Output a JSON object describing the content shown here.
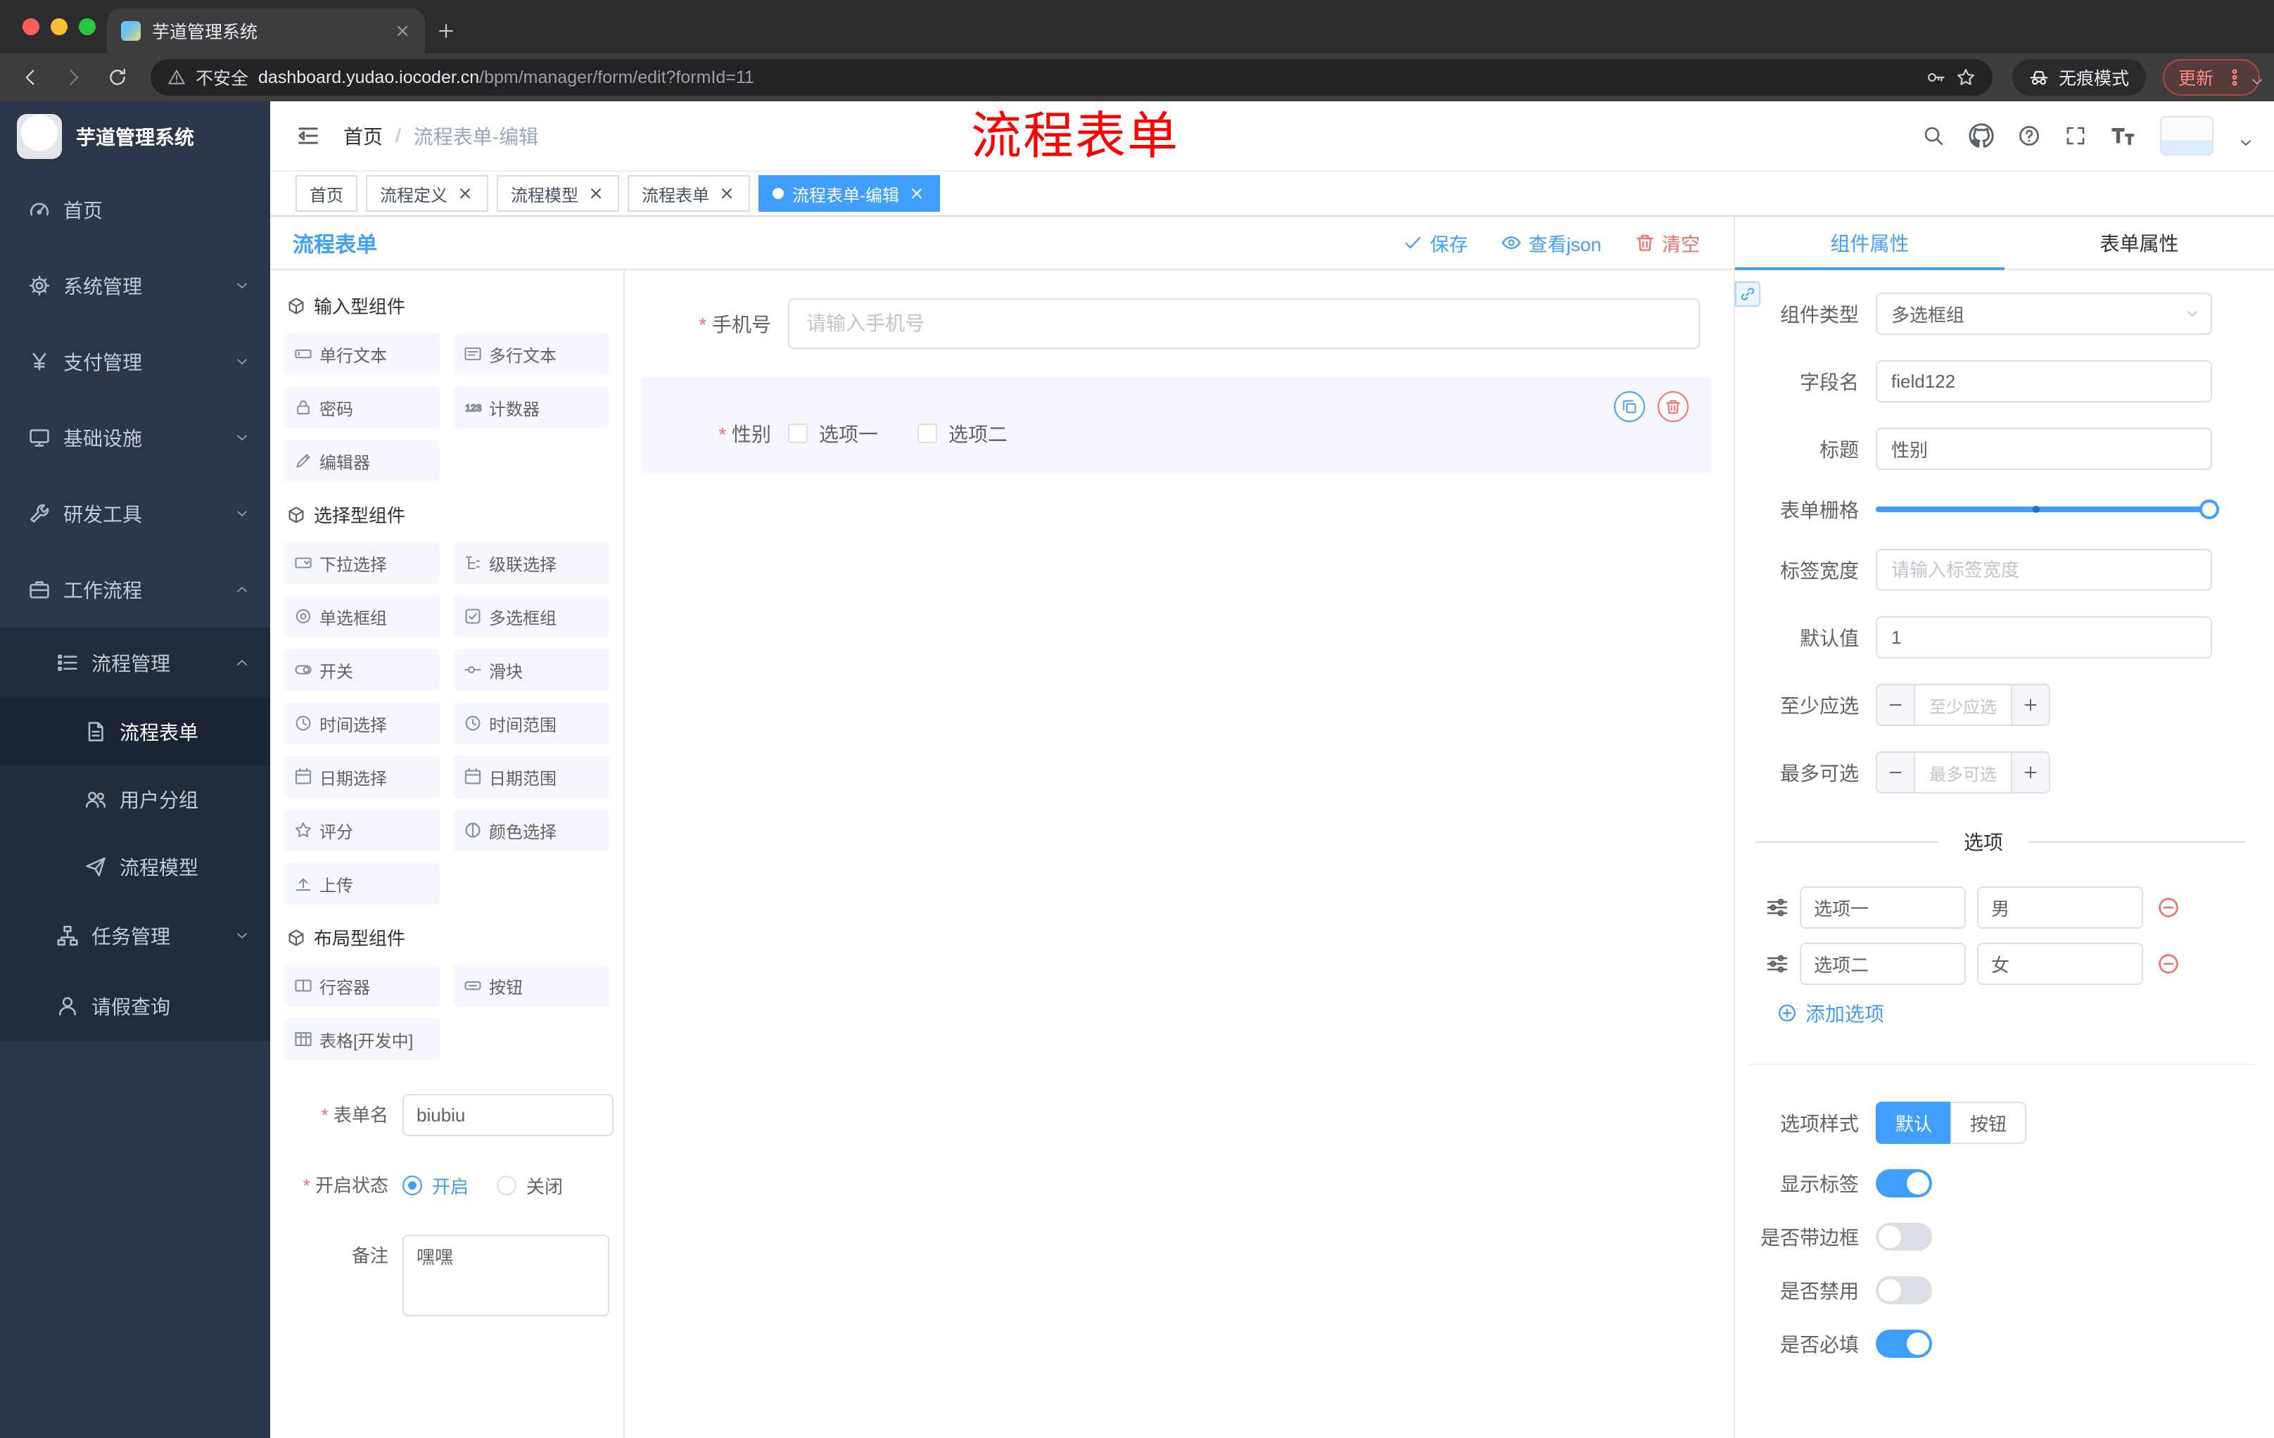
{
  "colors": {
    "accent": "#409eff",
    "danger": "#f56c6c",
    "annotation": "#ff0000"
  },
  "browser": {
    "tab_title": "芋道管理系统",
    "security": "不安全",
    "url_host": "dashboard.yudao.iocoder.cn",
    "url_path": "/bpm/manager/form/edit?formId=11",
    "incognito": "无痕模式",
    "update": "更新"
  },
  "sidebar": {
    "logo_title": "芋道管理系统",
    "items": [
      {
        "label": "首页",
        "icon": "dashboard-icon"
      },
      {
        "label": "系统管理",
        "icon": "gear-icon"
      },
      {
        "label": "支付管理",
        "icon": "yen-icon"
      },
      {
        "label": "基础设施",
        "icon": "monitor-icon"
      },
      {
        "label": "研发工具",
        "icon": "wrench-icon"
      },
      {
        "label": "工作流程",
        "icon": "briefcase-icon"
      },
      {
        "label": "流程管理",
        "icon": "list-icon"
      },
      {
        "label": "流程表单",
        "icon": "form-icon"
      },
      {
        "label": "用户分组",
        "icon": "users-icon"
      },
      {
        "label": "流程模型",
        "icon": "send-icon"
      },
      {
        "label": "任务管理",
        "icon": "tree-icon"
      },
      {
        "label": "请假查询",
        "icon": "user-icon"
      }
    ]
  },
  "header": {
    "breadcrumb_home": "首页",
    "breadcrumb_sep": "/",
    "breadcrumb_current": "流程表单-编辑",
    "annotation": "流程表单"
  },
  "page_tabs": [
    {
      "label": "首页",
      "closable": false,
      "active": false
    },
    {
      "label": "流程定义",
      "closable": true,
      "active": false
    },
    {
      "label": "流程模型",
      "closable": true,
      "active": false
    },
    {
      "label": "流程表单",
      "closable": true,
      "active": false
    },
    {
      "label": "流程表单-编辑",
      "closable": true,
      "active": true
    }
  ],
  "designer": {
    "panel_title": "流程表单",
    "toolbar": {
      "save": "保存",
      "view_json": "查看json",
      "clear": "清空"
    },
    "palette": {
      "groups": [
        {
          "title": "输入型组件",
          "items": [
            {
              "label": "单行文本",
              "icon": "input-icon"
            },
            {
              "label": "多行文本",
              "icon": "textarea-icon"
            },
            {
              "label": "密码",
              "icon": "password-icon"
            },
            {
              "label": "计数器",
              "icon": "counter-icon"
            },
            {
              "label": "编辑器",
              "icon": "editor-icon"
            }
          ]
        },
        {
          "title": "选择型组件",
          "items": [
            {
              "label": "下拉选择",
              "icon": "select-icon"
            },
            {
              "label": "级联选择",
              "icon": "cascader-icon"
            },
            {
              "label": "单选框组",
              "icon": "radio-group-icon"
            },
            {
              "label": "多选框组",
              "icon": "checkbox-group-icon"
            },
            {
              "label": "开关",
              "icon": "switch-icon"
            },
            {
              "label": "滑块",
              "icon": "slider-icon"
            },
            {
              "label": "时间选择",
              "icon": "time-icon"
            },
            {
              "label": "时间范围",
              "icon": "time-range-icon"
            },
            {
              "label": "日期选择",
              "icon": "date-icon"
            },
            {
              "label": "日期范围",
              "icon": "date-range-icon"
            },
            {
              "label": "评分",
              "icon": "rate-icon"
            },
            {
              "label": "颜色选择",
              "icon": "color-icon"
            },
            {
              "label": "上传",
              "icon": "upload-icon"
            }
          ]
        },
        {
          "title": "布局型组件",
          "items": [
            {
              "label": "行容器",
              "icon": "row-container-icon"
            },
            {
              "label": "按钮",
              "icon": "button-icon"
            },
            {
              "label": "表格[开发中]",
              "icon": "table-icon"
            }
          ]
        }
      ]
    },
    "form_config": {
      "name_label": "表单名",
      "name_value": "biubiu",
      "status_label": "开启状态",
      "status_on": "开启",
      "status_off": "关闭",
      "remark_label": "备注",
      "remark_value": "嘿嘿"
    },
    "canvas": {
      "phone_label": "手机号",
      "phone_placeholder": "请输入手机号",
      "gender_label": "性别",
      "gender_option1": "选项一",
      "gender_option2": "选项二"
    }
  },
  "properties": {
    "tab_component": "组件属性",
    "tab_form": "表单属性",
    "component_type_label": "组件类型",
    "component_type_value": "多选框组",
    "field_name_label": "字段名",
    "field_name_value": "field122",
    "title_label": "标题",
    "title_value": "性别",
    "grid_label": "表单栅格",
    "label_width_label": "标签宽度",
    "label_width_placeholder": "请输入标签宽度",
    "default_label": "默认值",
    "default_value": "1",
    "min_label": "至少应选",
    "min_placeholder": "至少应选",
    "max_label": "最多可选",
    "max_placeholder": "最多可选",
    "options_divider": "选项",
    "options": [
      {
        "label": "选项一",
        "value": "男"
      },
      {
        "label": "选项二",
        "value": "女"
      }
    ],
    "add_option": "添加选项",
    "style_label": "选项样式",
    "style_default": "默认",
    "style_button": "按钮",
    "toggles": [
      {
        "label": "显示标签",
        "on": true
      },
      {
        "label": "是否带边框",
        "on": false
      },
      {
        "label": "是否禁用",
        "on": false
      },
      {
        "label": "是否必填",
        "on": true
      }
    ]
  }
}
